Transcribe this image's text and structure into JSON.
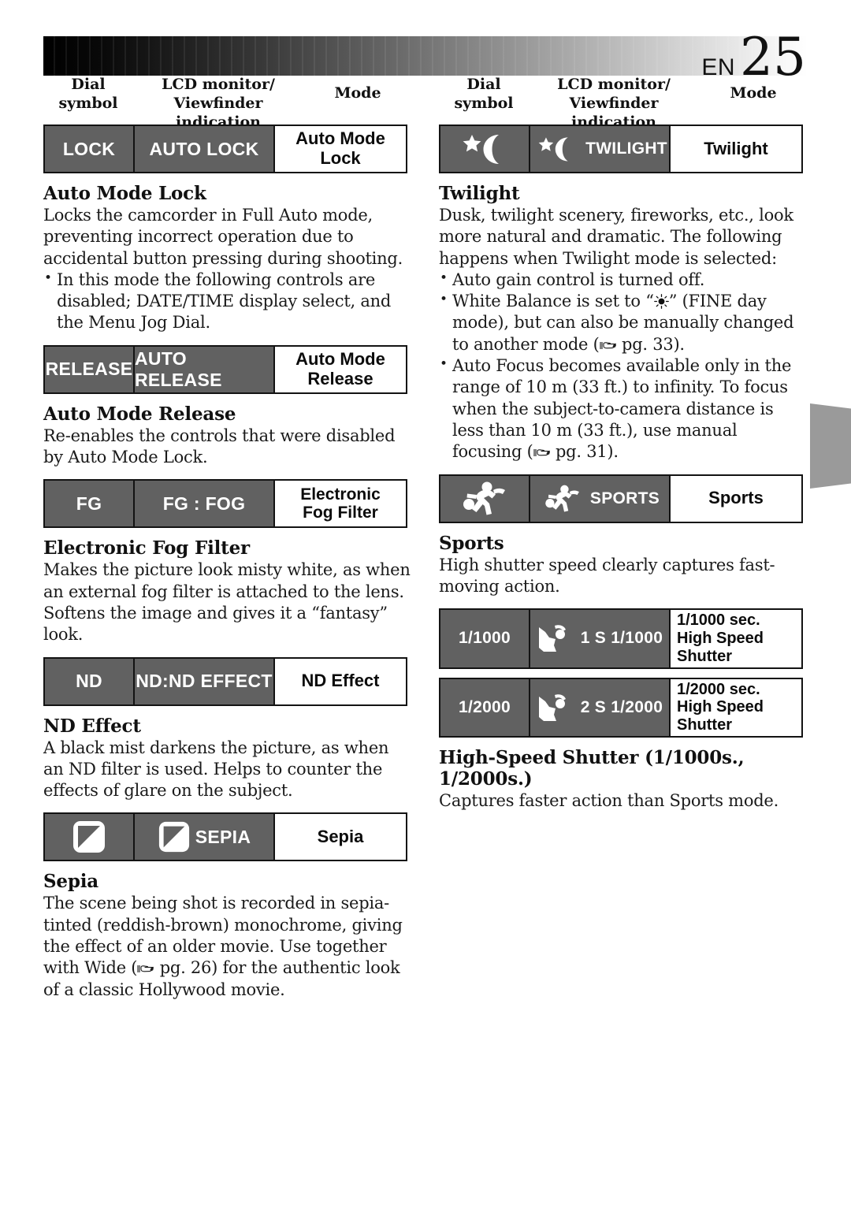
{
  "page": {
    "lang_code": "EN",
    "number": "25",
    "header_gradient_from": "#000000",
    "header_gradient_to": "#ffffff",
    "cell_gray": "#616161",
    "border_color": "#131313"
  },
  "columns": {
    "headers": {
      "dial_symbol_line1": "Dial",
      "dial_symbol_line2": "symbol",
      "lcd_line1": "LCD monitor/",
      "lcd_line2": "Viewfinder indication",
      "mode": "Mode"
    }
  },
  "left_column": {
    "rows": [
      {
        "dial": "LOCK",
        "lcd": "AUTO LOCK",
        "mode": "Auto Mode Lock",
        "dial_icon": "",
        "lcd_icon": ""
      },
      {
        "dial": "RELEASE",
        "lcd": "AUTO RELEASE",
        "mode": "Auto Mode Release",
        "dial_icon": "",
        "lcd_icon": ""
      },
      {
        "dial": "FG",
        "lcd": "FG : FOG",
        "mode_line1": "Electronic",
        "mode_line2": "Fog Filter",
        "dial_icon": "",
        "lcd_icon": ""
      },
      {
        "dial": "ND",
        "lcd": "ND:ND EFFECT",
        "mode": "ND Effect",
        "dial_icon": "",
        "lcd_icon": ""
      },
      {
        "dial": "",
        "lcd": "SEPIA",
        "mode": "Sepia",
        "dial_icon": "sepia-icon",
        "lcd_icon": "sepia-icon"
      }
    ],
    "sections": [
      {
        "title": "Auto Mode Lock",
        "body": "Locks the camcorder in Full Auto mode, preventing incorrect operation due to accidental button pressing during shooting.",
        "bullets": [
          "In this mode the following controls are disabled; DATE/TIME display select, and the Menu Jog Dial."
        ]
      },
      {
        "title": "Auto Mode Release",
        "body": "Re-enables the controls that were disabled by Auto Mode Lock.",
        "bullets": []
      },
      {
        "title": "Electronic Fog Filter",
        "body": "Makes the picture look misty white, as when an external fog filter is attached to the lens. Softens the image and gives it a “fantasy” look.",
        "bullets": []
      },
      {
        "title": "ND Effect",
        "body": "A black mist darkens the picture, as when an ND filter is used. Helps to counter the effects of glare on the subject.",
        "bullets": []
      },
      {
        "title": "Sepia",
        "body_part1": "The scene being shot is recorded in sepia-tinted (reddish-brown) monochrome, giving the effect of an older movie. Use together with Wide (",
        "body_page_ref": " pg. 26)",
        "body_part2": " for the authentic look of a classic Hollywood movie.",
        "bullets": []
      }
    ]
  },
  "right_column": {
    "rows": [
      {
        "dial": "",
        "lcd": "TWILIGHT",
        "mode": "Twilight",
        "dial_icon": "twilight-moon-star-icon",
        "lcd_icon": "twilight-moon-star-icon"
      },
      {
        "dial": "",
        "lcd": "SPORTS",
        "mode": "Sports",
        "dial_icon": "sports-runner-icon",
        "lcd_icon": "sports-runner-icon"
      },
      {
        "dial": "1/1000",
        "lcd_number": "1",
        "lcd": "S 1/1000",
        "mode_line1": "1/1000 sec.",
        "mode_line2": "High Speed Shutter",
        "dial_icon": "",
        "lcd_icon": "golfer-icon"
      },
      {
        "dial": "1/2000",
        "lcd_number": "2",
        "lcd": "S 1/2000",
        "mode_line1": "1/2000 sec.",
        "mode_line2": "High Speed Shutter",
        "dial_icon": "",
        "lcd_icon": "golfer-icon"
      }
    ],
    "sections": [
      {
        "title": "Twilight",
        "body": "Dusk, twilight scenery, fireworks, etc., look more natural and dramatic. The following happens when Twilight mode is selected:",
        "bullet1": "Auto gain control is turned off.",
        "bullet2_part1": "White Balance is set to “",
        "bullet2_part2": "” (FINE day mode), but can also be manually changed to another mode (",
        "bullet2_page_ref": " pg. 33).",
        "bullet3_part1": "Auto Focus becomes available only in the range of 10 m (33 ft.) to infinity. To focus when the subject-to-camera distance is less than 10 m (33 ft.), use manual focusing (",
        "bullet3_page_ref": " pg. 31)."
      },
      {
        "title": "Sports",
        "body": "High shutter speed clearly captures fast-moving action."
      },
      {
        "title": "High-Speed Shutter (1/1000s., 1/2000s.)",
        "body": "Captures faster action than Sports mode."
      }
    ]
  }
}
